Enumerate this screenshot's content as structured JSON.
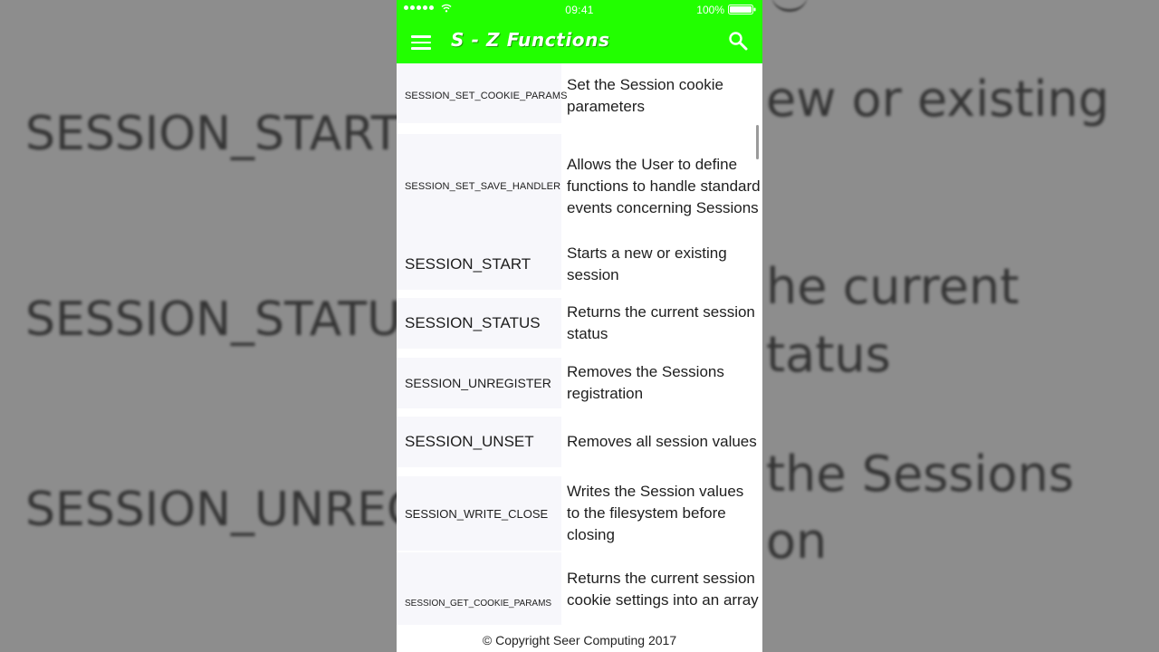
{
  "background": {
    "left_lines": [
      "SESSION_START",
      "SESSION_STATU",
      "SESSION_UNREGIS"
    ],
    "right_lines": [
      "ew or existing",
      "he current",
      "tatus",
      "the Sessions",
      "on"
    ]
  },
  "status_bar": {
    "time": "09:41",
    "battery": "100%",
    "signal_icon": "signal-dots-icon",
    "wifi_icon": "wifi-icon",
    "battery_icon": "battery-icon"
  },
  "app_bar": {
    "title": "S - Z Functions",
    "menu_icon": "hamburger-menu-icon",
    "search_icon": "search-icon",
    "color": "#22ff00"
  },
  "functions": [
    {
      "name": "SESSION_SET_COOKIE_PARAMS",
      "description": "Set the Session cookie parameters"
    },
    {
      "name": "SESSION_SET_SAVE_HANDLER",
      "description": "Allows the User to define functions to handle standard events concerning Sessions"
    },
    {
      "name": "SESSION_START",
      "description": "Starts a new or existing session"
    },
    {
      "name": "SESSION_STATUS",
      "description": "Returns the current session status"
    },
    {
      "name": "SESSION_UNREGISTER",
      "description": "Removes the Sessions registration"
    },
    {
      "name": "SESSION_UNSET",
      "description": "Removes all session values"
    },
    {
      "name": "SESSION_WRITE_CLOSE",
      "description": "Writes the Session values to the filesystem before closing"
    },
    {
      "name": "SESSION_GET_COOKIE_PARAMS",
      "description": "Returns the current session cookie settings into an array"
    }
  ],
  "footer": {
    "text": "© Copyright Seer Computing 2017"
  }
}
